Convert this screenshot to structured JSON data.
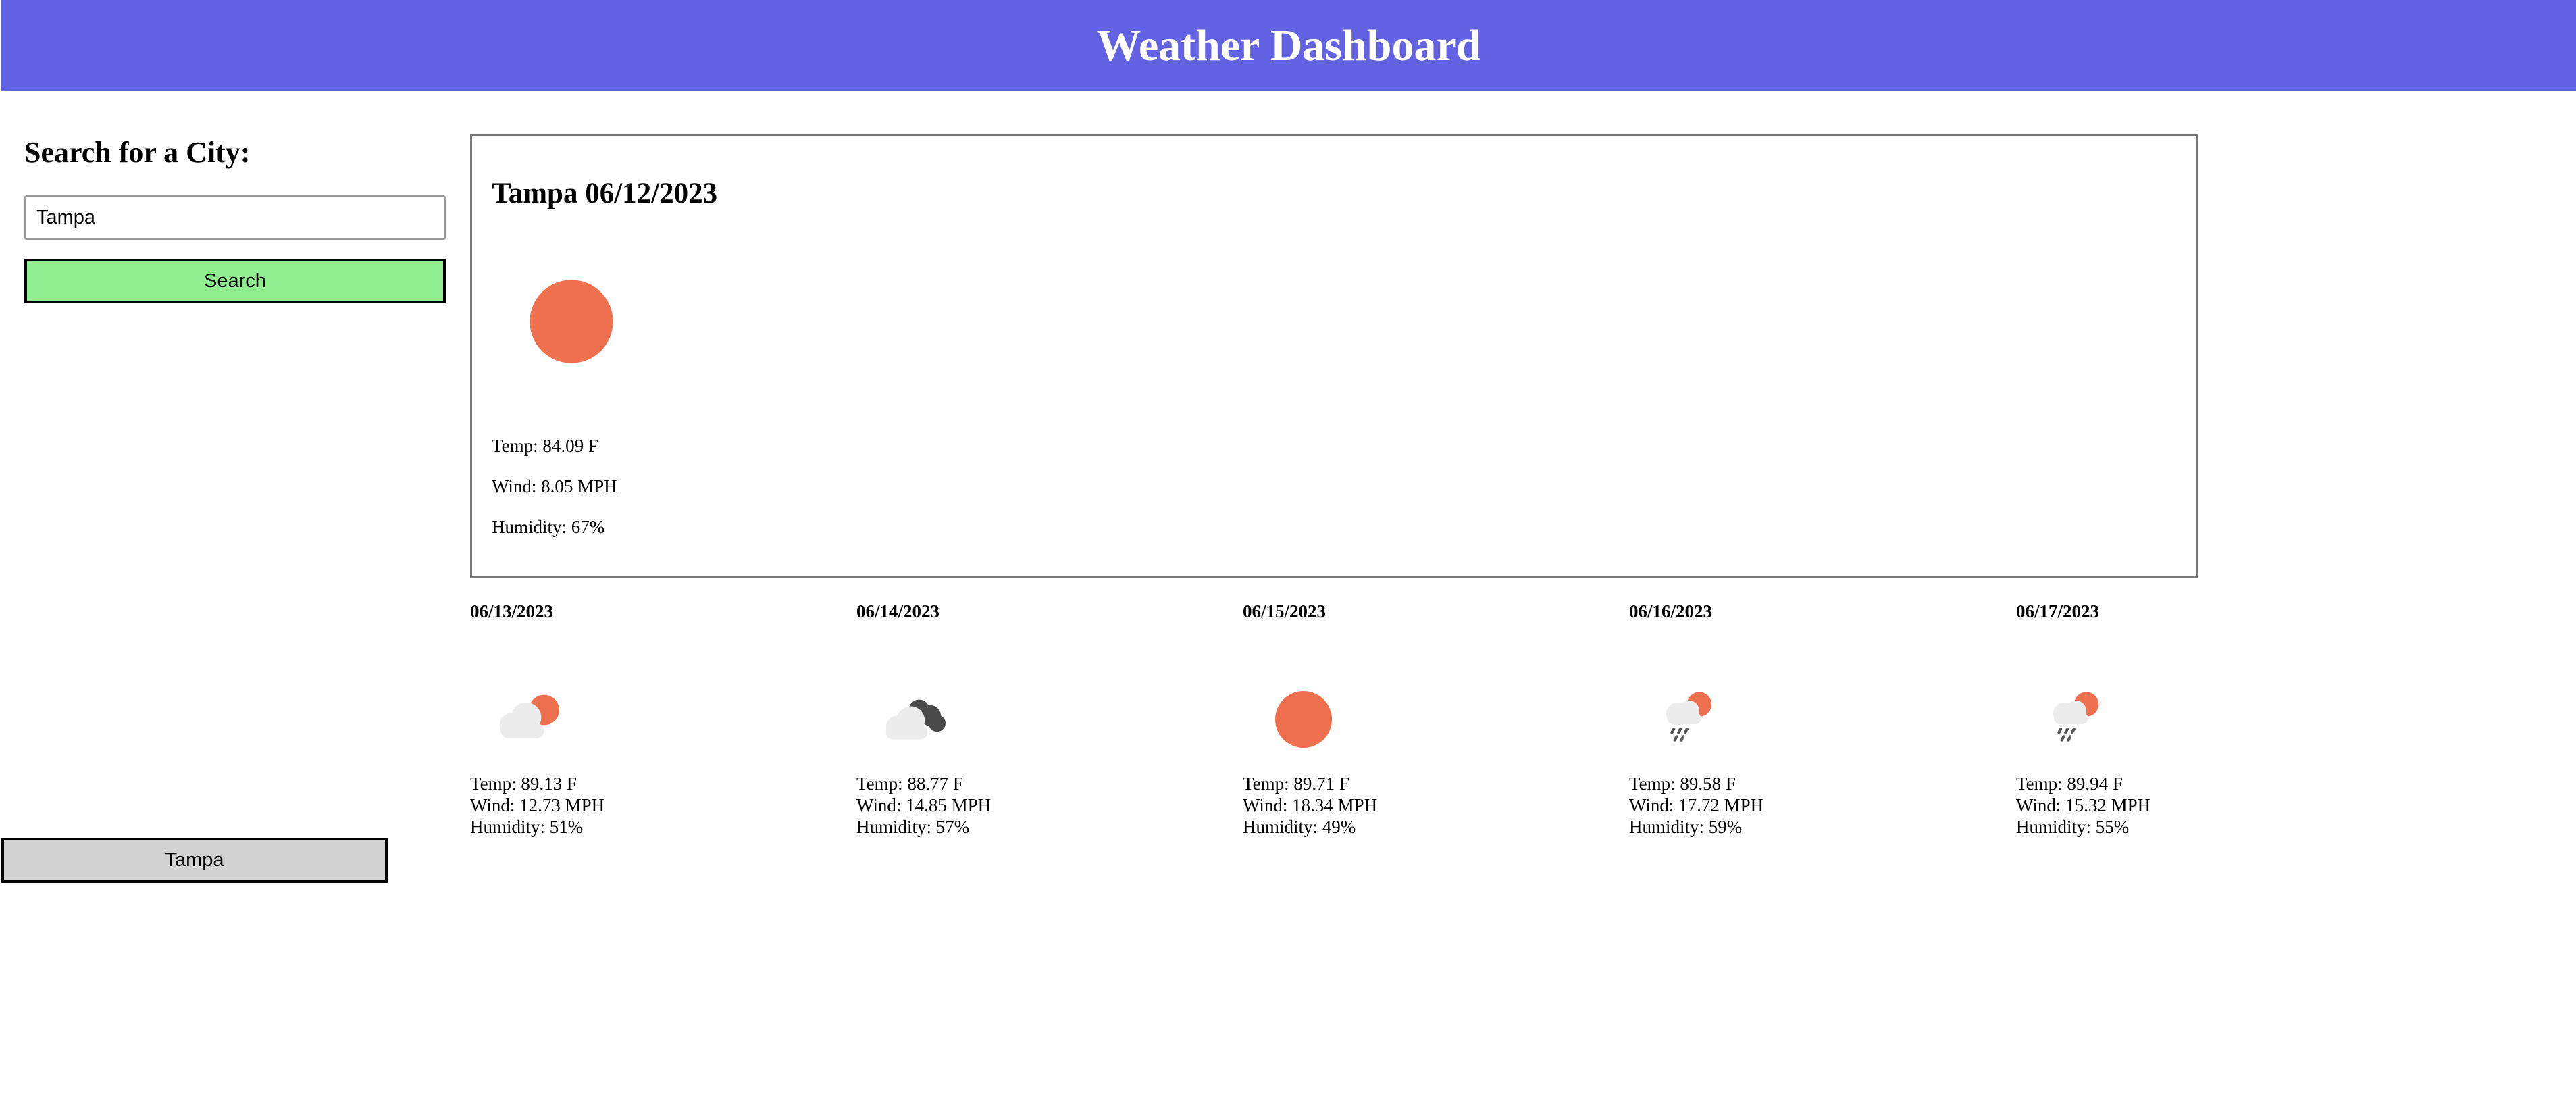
{
  "header": {
    "title": "Weather Dashboard"
  },
  "search": {
    "heading": "Search for a City:",
    "input_value": "Tampa",
    "button_label": "Search"
  },
  "history": [
    {
      "label": "Tampa"
    }
  ],
  "current": {
    "title": "Tampa 06/12/2023",
    "icon": "sun-icon",
    "temp": "Temp: 84.09 F",
    "wind": "Wind: 8.05 MPH",
    "humidity": "Humidity: 67%"
  },
  "forecast": [
    {
      "date": "06/13/2023",
      "icon": "partly-cloudy-icon",
      "temp": "Temp: 89.13 F",
      "wind": "Wind: 12.73 MPH",
      "humidity": "Humidity: 51%"
    },
    {
      "date": "06/14/2023",
      "icon": "cloudy-icon",
      "temp": "Temp: 88.77 F",
      "wind": "Wind: 14.85 MPH",
      "humidity": "Humidity: 57%"
    },
    {
      "date": "06/15/2023",
      "icon": "sun-icon",
      "temp": "Temp: 89.71 F",
      "wind": "Wind: 18.34 MPH",
      "humidity": "Humidity: 49%"
    },
    {
      "date": "06/16/2023",
      "icon": "rain-sun-icon",
      "temp": "Temp: 89.58 F",
      "wind": "Wind: 17.72 MPH",
      "humidity": "Humidity: 59%"
    },
    {
      "date": "06/17/2023",
      "icon": "rain-sun-icon",
      "temp": "Temp: 89.94 F",
      "wind": "Wind: 15.32 MPH",
      "humidity": "Humidity: 55%"
    }
  ],
  "colors": {
    "header_bg": "#6262e2",
    "search_button_bg": "#90ee90",
    "history_button_bg": "#d3d3d3",
    "sun": "#ee704f",
    "cloud_light": "#ececec",
    "cloud_dark": "#4a4a4a"
  }
}
